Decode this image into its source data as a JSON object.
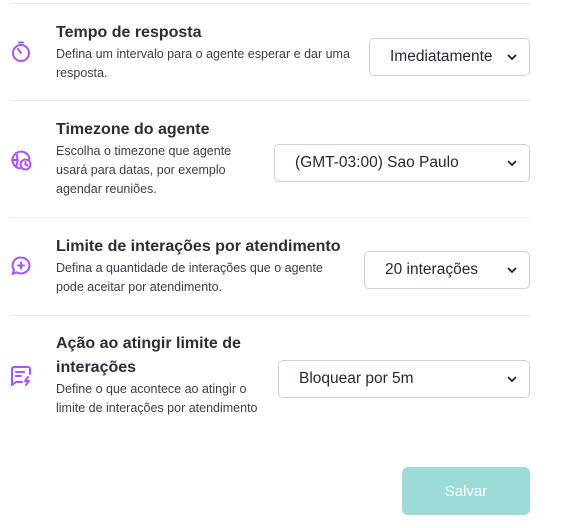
{
  "settings": [
    {
      "title": "Tempo de resposta",
      "description_lines": [
        "Defina um intervalo para o agente esperar e dar uma",
        "resposta."
      ],
      "selected": "Imediatamente",
      "icon": "timer-icon"
    },
    {
      "title": "Timezone do agente",
      "description_lines": [
        "Escolha o timezone que agente",
        "usará para datas, por exemplo",
        "agendar reuniões."
      ],
      "selected": "(GMT-03:00) Sao Paulo",
      "icon": "clock-globe-icon"
    },
    {
      "title": "Limite de interações por atendimento",
      "description_lines": [
        "Defina a quantidade de interações que o agente",
        "pode aceitar por atendimento."
      ],
      "selected": "20 interações",
      "icon": "chat-plus-icon"
    },
    {
      "title_lines": [
        "Ação ao atingir limite de",
        "interações"
      ],
      "description_lines": [
        "Define o que acontece ao atingir o",
        "limite de interações por atendimento"
      ],
      "selected": "Bloquear por 5m",
      "icon": "message-bolt-icon"
    }
  ],
  "save_label": "Salvar",
  "colors": {
    "accent": "#a855f7",
    "save_button_bg": "#9bdcd9",
    "divider": "#eeeeee"
  }
}
